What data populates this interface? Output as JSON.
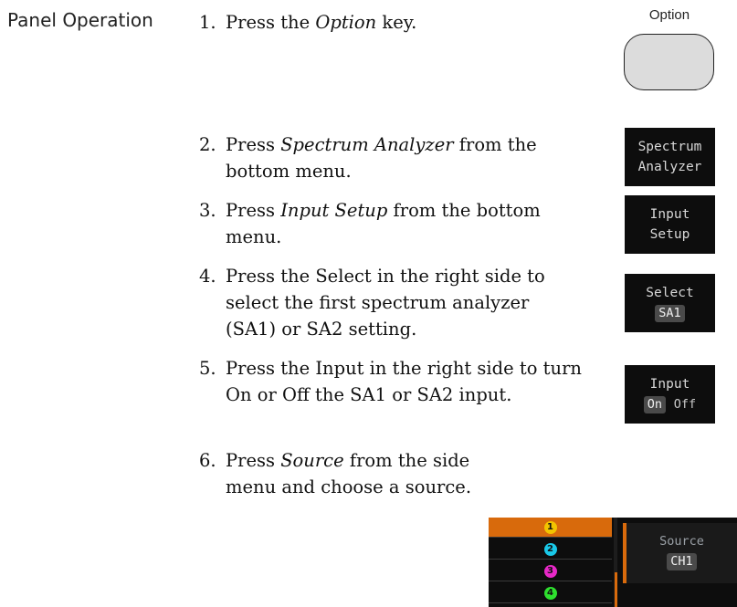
{
  "section_label": "Panel Operation",
  "steps": [
    {
      "num": "1.",
      "pre": "Press the ",
      "em": "Option",
      "post": " key."
    },
    {
      "num": "2.",
      "pre": "Press ",
      "em": "Spectrum Analyzer",
      "post": " from the bottom menu."
    },
    {
      "num": "3.",
      "pre": "Press ",
      "em": "Input Setup",
      "post": " from the bottom menu."
    },
    {
      "num": "4.",
      "text": "Press the Select in the right side to select the first spectrum analyzer (SA1) or SA2 setting."
    },
    {
      "num": "5.",
      "text": "Press the Input in the right side to turn On or Off the SA1 or SA2 input."
    },
    {
      "num": "6.",
      "pre": "Press ",
      "em": "Source",
      "post": " from the side menu and choose a source."
    }
  ],
  "keys": {
    "option_caption": "Option",
    "spectrum": [
      "Spectrum",
      "Analyzer"
    ],
    "input_setup": [
      "Input",
      "Setup"
    ],
    "select_title": "Select",
    "select_value": "SA1",
    "input_title": "Input",
    "input_on": "On",
    "input_off": "Off"
  },
  "channel_menu": {
    "channels": [
      {
        "label": "1",
        "color": "#f2c400",
        "selected": true
      },
      {
        "label": "2",
        "color": "#19c8e8",
        "selected": false
      },
      {
        "label": "3",
        "color": "#e828c8",
        "selected": false
      },
      {
        "label": "4",
        "color": "#2ee02e",
        "selected": false
      }
    ],
    "source_title": "Source",
    "source_value": "CH1"
  }
}
